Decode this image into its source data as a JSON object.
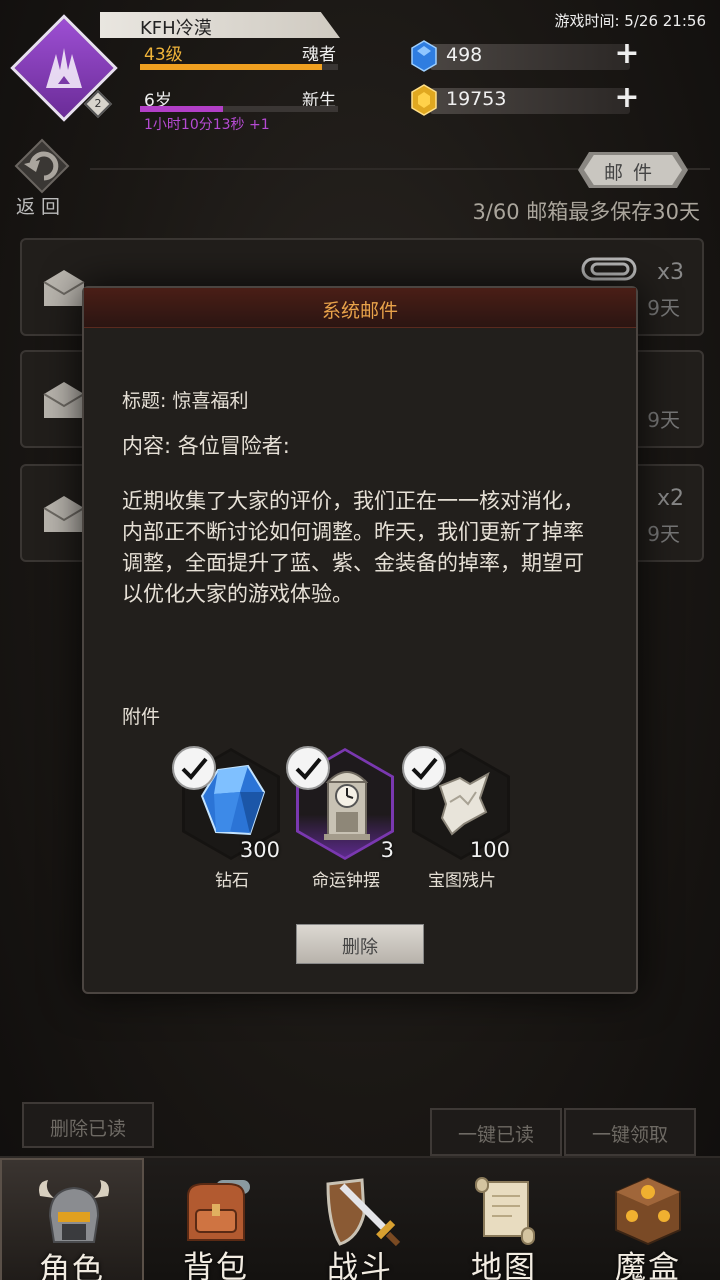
{
  "player": {
    "name": "KFH冷漠",
    "level": "43级",
    "title": "魂者",
    "age": "6岁",
    "stage": "新生",
    "timer": "1小时10分13秒 +1",
    "badge": "2",
    "level_progress": 0.92,
    "age_progress": 0.42
  },
  "resources": {
    "diamond": "498",
    "gold": "19753"
  },
  "game_time": "游戏时间: 5/26 21:56",
  "back_label": "返回",
  "mail_tab_label": "邮件",
  "mailbox_info": "3/60 邮箱最多保存30天",
  "mail_rows": [
    {
      "count": "x3",
      "days": "9天"
    },
    {
      "count": "",
      "days": "9天"
    },
    {
      "count": "x2",
      "days": "9天"
    }
  ],
  "modal": {
    "header": "系统邮件",
    "title": "标题: 惊喜福利",
    "content_label": "内容: 各位冒险者:",
    "body": "近期收集了大家的评价，我们正在一一核对消化，内部正不断讨论如何调整。昨天，我们更新了掉率调整，全面提升了蓝、紫、金装备的掉率，期望可以优化大家的游戏体验。",
    "attach_label": "附件",
    "attachments": [
      {
        "name": "钻石",
        "qty": "300",
        "rarity": "normal",
        "icon": "diamond-icon"
      },
      {
        "name": "命运钟摆",
        "qty": "3",
        "rarity": "purple",
        "icon": "clock-icon"
      },
      {
        "name": "宝图残片",
        "qty": "100",
        "rarity": "normal",
        "icon": "map-fragment-icon"
      }
    ],
    "delete_label": "删除"
  },
  "buttons": {
    "delete_read": "删除已读",
    "read_all": "一键已读",
    "claim_all": "一键领取"
  },
  "nav": [
    {
      "label": "角色",
      "icon": "helmet-icon",
      "active": true
    },
    {
      "label": "背包",
      "icon": "backpack-icon",
      "active": false
    },
    {
      "label": "战斗",
      "icon": "sword-shield-icon",
      "active": false
    },
    {
      "label": "地图",
      "icon": "scroll-map-icon",
      "active": false
    },
    {
      "label": "魔盒",
      "icon": "magic-box-icon",
      "active": false
    }
  ],
  "colors": {
    "accent_orange": "#f0a020",
    "accent_purple": "#b23fc7",
    "modal_header_text": "#e8a24a"
  }
}
